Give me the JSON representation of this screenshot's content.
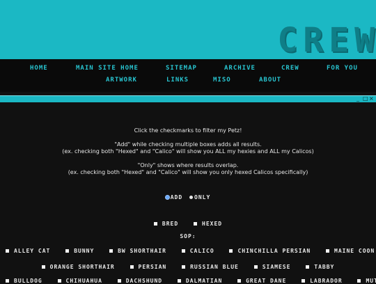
{
  "banner": {
    "logo": "CREW",
    "bg": "#1bb8c4"
  },
  "nav": {
    "items": [
      "HOME",
      "MAIN SITE HOME",
      "SITEMAP",
      "ARCHIVE",
      "CREW",
      "FOR YOU",
      "ARTWORK",
      "LINKS",
      "MISO",
      "ABOUT"
    ]
  },
  "window": {
    "minimize": "_",
    "maximize": "□",
    "close": "×"
  },
  "intro": {
    "line1": "Click the checkmarks to filter my Petz!",
    "line2": "\"Add\" while checking multiple boxes adds all results.",
    "line3": "(ex. checking both \"Hexed\" and \"Calico\" will show you ALL my hexies and ALL my Calicos)",
    "line4": "\"Only\" shows where results overlap.",
    "line5": "(ex. checking both \"Hexed\" and \"Calico\" will show you only hexed Calicos specifically)"
  },
  "mode": {
    "add": "ADD",
    "only": "ONLY",
    "selected": "ADD"
  },
  "type_filters": [
    "BRED",
    "HEXED"
  ],
  "sop_label": "SOP:",
  "sop_row1": [
    "ALLEY CAT",
    "BUNNY",
    "BW SHORTHAIR",
    "CALICO",
    "CHINCHILLA PERSIAN",
    "MAINE COON"
  ],
  "sop_row2": [
    "ORANGE SHORTHAIR",
    "PERSIAN",
    "RUSSIAN BLUE",
    "SIAMESE",
    "TABBY"
  ],
  "sop_row3": [
    "BULLDOG",
    "CHIHUAHUA",
    "DACHSHUND",
    "DALMATIAN",
    "GREAT DANE",
    "LABRADOR",
    "MUTT"
  ]
}
